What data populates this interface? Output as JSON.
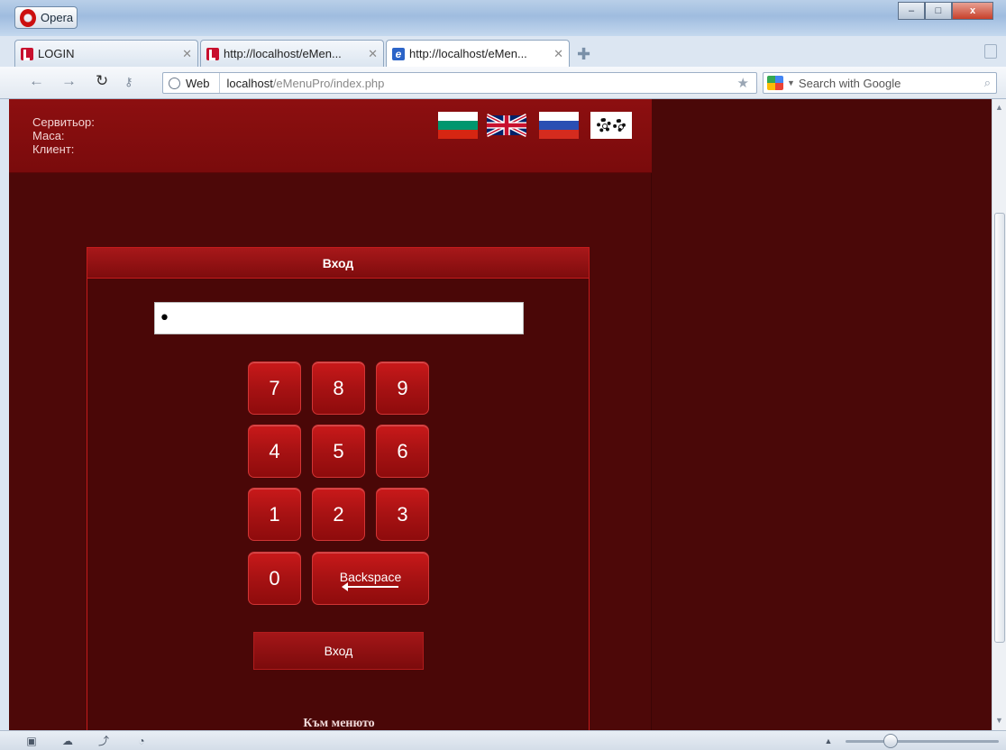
{
  "window": {
    "menu_label": "Opera",
    "controls": {
      "minimize": "–",
      "maximize": "□",
      "close": "x"
    }
  },
  "tabs": [
    {
      "label": "LOGIN",
      "favicon": "opera-icon"
    },
    {
      "label": "http://localhost/eMen...",
      "favicon": "opera-icon"
    },
    {
      "label": "http://localhost/eMen...",
      "favicon": "explorer-icon",
      "active": true
    }
  ],
  "addressbar": {
    "site_label": "Web",
    "url_host": "localhost",
    "url_path": "/eMenuPro/index.php",
    "search_placeholder": "Search with Google"
  },
  "header": {
    "waiter_label": "Сервитьор:",
    "table_label": "Маса:",
    "client_label": "Клиент:"
  },
  "login": {
    "title": "Вход",
    "pin_value": "•",
    "keys": [
      "7",
      "8",
      "9",
      "4",
      "5",
      "6",
      "1",
      "2",
      "3",
      "0"
    ],
    "backspace_label": "Backspace",
    "submit_label": "Вход",
    "menu_link": "Към менюто"
  },
  "colors": {
    "page_bg": "#4d0808",
    "header_bg": "#8d0f10",
    "accent_border": "#c41b1b",
    "key_bg": "#a71213"
  }
}
